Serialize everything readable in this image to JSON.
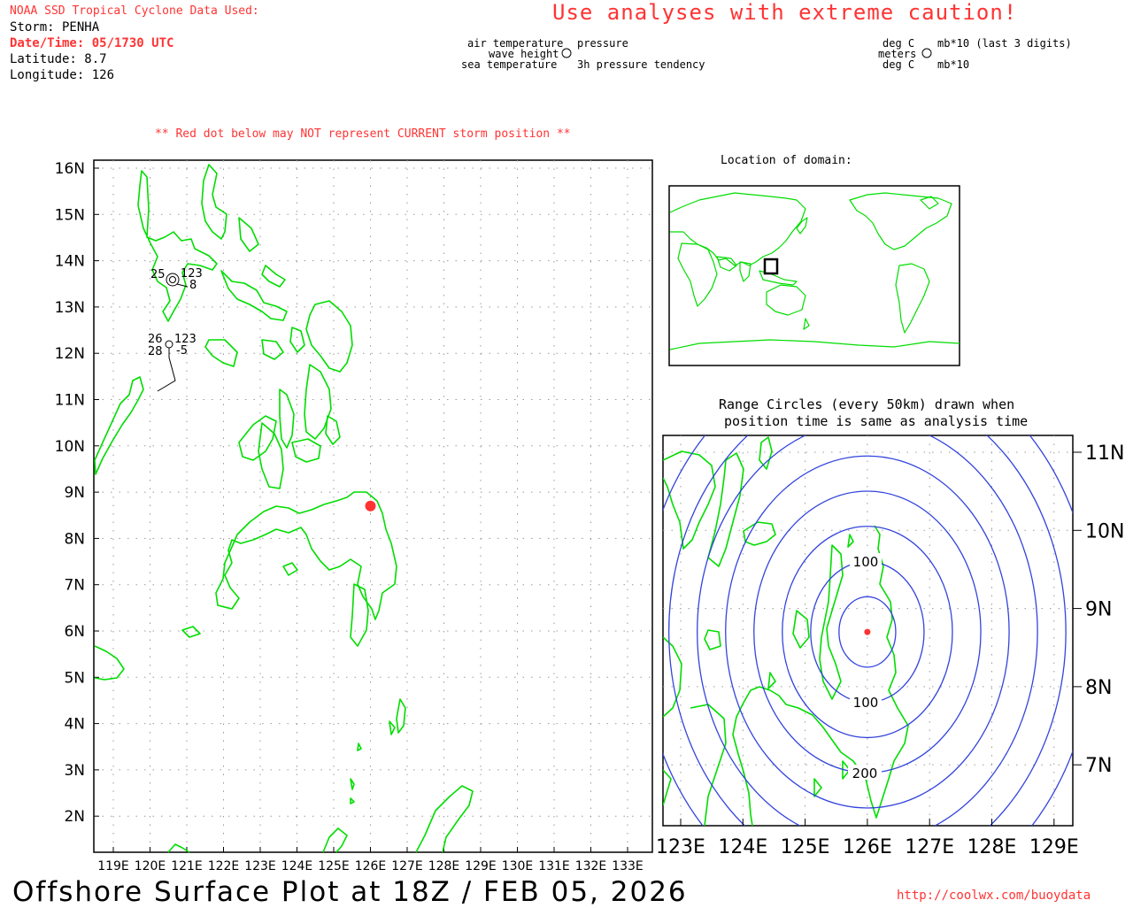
{
  "header": {
    "source": "NOAA SSD Tropical Cyclone Data Used:",
    "storm": "Storm: PENHA",
    "datetime": "Date/Time: 05/1730 UTC",
    "latitude": "Latitude: 8.7",
    "longitude": "Longitude: 126",
    "caution": "Use analyses with extreme caution!"
  },
  "legend": {
    "air_temperature": "air temperature",
    "wave_height": "wave height",
    "sea_temperature": "sea temperature",
    "pressure": "pressure",
    "pressure_tendency": "3h pressure tendency",
    "unit_air": "deg C",
    "unit_wave": "meters",
    "unit_sea": "deg C",
    "unit_pressure": "mb*10 (last 3 digits)",
    "unit_tendency": "mb*10"
  },
  "warning": "** Red dot below may NOT represent CURRENT storm position **",
  "main_map": {
    "lat_labels": [
      "16N",
      "15N",
      "14N",
      "13N",
      "12N",
      "11N",
      "10N",
      "9N",
      "8N",
      "7N",
      "6N",
      "5N",
      "4N",
      "3N",
      "2N"
    ],
    "lon_labels": [
      "119E",
      "120E",
      "121E",
      "122E",
      "123E",
      "124E",
      "125E",
      "126E",
      "127E",
      "128E",
      "129E",
      "130E",
      "131E",
      "132E",
      "133E"
    ],
    "storm_position": {
      "lat": 8.7,
      "lon": 126
    },
    "stations": [
      {
        "air_temp": "25",
        "pressure": "123",
        "tendency": "8"
      },
      {
        "air_temp": "26",
        "pressure": "123",
        "sea_temp": "28",
        "tendency": "-5"
      }
    ]
  },
  "location_map": {
    "title": "Location of domain:"
  },
  "range_map": {
    "title_line1": "Range Circles (every 50km) drawn when",
    "title_line2": "position time is same as analysis time",
    "lat_labels": [
      "11N",
      "10N",
      "9N",
      "8N",
      "7N"
    ],
    "lon_labels": [
      "123E",
      "124E",
      "125E",
      "126E",
      "127E",
      "128E",
      "129E"
    ],
    "circle_labels": [
      "100",
      "100",
      "200"
    ],
    "circle_interval_km": 50
  },
  "footer": {
    "title": "Offshore Surface Plot at 18Z / FEB 05, 2026",
    "url": "http://coolwx.com/buoydata"
  },
  "colors": {
    "land": "#00dd00",
    "storm": "#ff3333",
    "range_circles": "#3344dd",
    "caution": "#ff3333"
  }
}
